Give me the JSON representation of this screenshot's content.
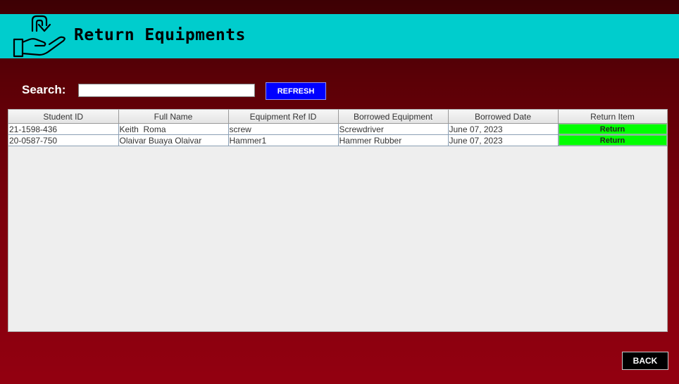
{
  "header": {
    "title": "Return Equipments",
    "icon": "return-hand-icon",
    "background": "#00cdcd"
  },
  "search": {
    "label": "Search:",
    "value": "",
    "placeholder": ""
  },
  "refresh_label": "REFRESH",
  "table": {
    "columns": [
      "Student ID",
      "Full Name",
      "Equipment Ref ID",
      "Borrowed Equipment",
      "Borrowed Date",
      "Return Item"
    ],
    "rows": [
      {
        "student_id": "21-1598-436",
        "full_name": "Keith  Roma",
        "ref_id": "screw",
        "equipment": "Screwdriver",
        "date": "June 07, 2023",
        "action": "Return"
      },
      {
        "student_id": "20-0587-750",
        "full_name": "Olaivar Buaya Olaivar",
        "ref_id": "Hammer1",
        "equipment": "Hammer Rubber",
        "date": "June 07, 2023",
        "action": "Return"
      }
    ]
  },
  "back_label": "BACK",
  "colors": {
    "accent": "#00cdcd",
    "refresh_button": "#0000ff",
    "return_button": "#00ff00",
    "background": "#7c000c"
  }
}
